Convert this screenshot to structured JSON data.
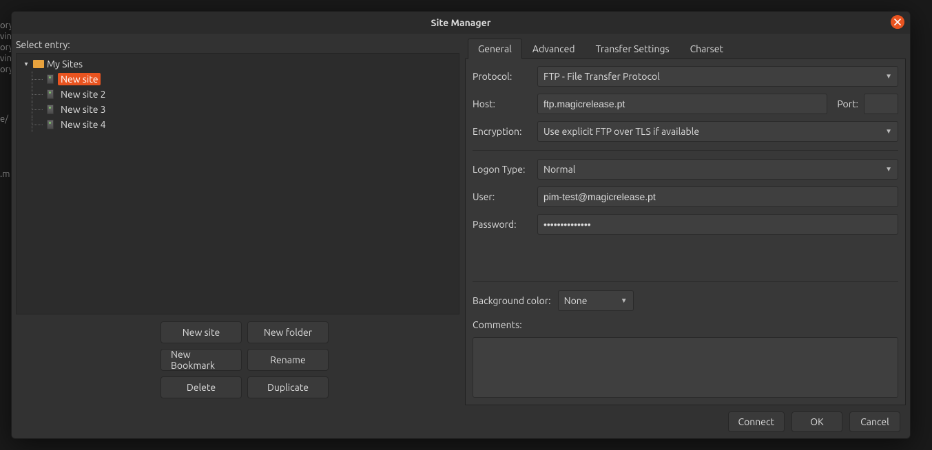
{
  "dialog": {
    "title": "Site Manager"
  },
  "left": {
    "select_label": "Select entry:",
    "root_label": "My Sites",
    "sites": [
      "New site",
      "New site 2",
      "New site 3",
      "New site 4"
    ],
    "selected_index": 0,
    "buttons": {
      "new_site": "New site",
      "new_folder": "New folder",
      "new_bookmark": "New Bookmark",
      "rename": "Rename",
      "delete": "Delete",
      "duplicate": "Duplicate"
    }
  },
  "tabs": [
    "General",
    "Advanced",
    "Transfer Settings",
    "Charset"
  ],
  "active_tab": 0,
  "form": {
    "protocol_label": "Protocol:",
    "protocol_value": "FTP - File Transfer Protocol",
    "host_label": "Host:",
    "host_value": "ftp.magicrelease.pt",
    "port_label": "Port:",
    "port_value": "",
    "encryption_label": "Encryption:",
    "encryption_value": "Use explicit FTP over TLS if available",
    "logon_label": "Logon Type:",
    "logon_value": "Normal",
    "user_label": "User:",
    "user_value": "pim-test@magicrelease.pt",
    "password_label": "Password:",
    "password_value": "••••••••••••••",
    "bg_label": "Background color:",
    "bg_value": "None",
    "comments_label": "Comments:",
    "comments_value": ""
  },
  "footer": {
    "connect": "Connect",
    "ok": "OK",
    "cancel": "Cancel"
  },
  "bg_fragments": {
    "a": "ory",
    "b": "vin",
    "c": "ory",
    "d": "vin",
    "e": "ory",
    "f": "e/",
    "g": ".m"
  }
}
